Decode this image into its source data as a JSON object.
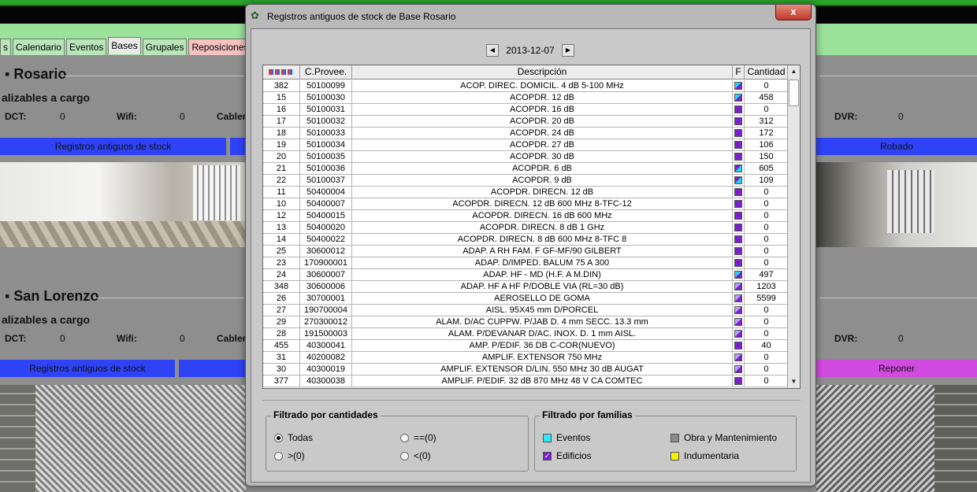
{
  "background": {
    "tabs": [
      "s",
      "Calendario",
      "Eventos",
      "Bases",
      "Grupales",
      "Reposiciones Exte"
    ],
    "active_tab": "Bases",
    "sections": [
      {
        "city": "Rosario",
        "subtitle": "alizables a cargo",
        "dct_label": "DCT:",
        "dct_value": "0",
        "wifi_label": "Wifi:",
        "wifi_value": "0",
        "cable_label": "Cabler",
        "dvr_label": "DVR:",
        "dvr_value": "0",
        "left_button": "Registros antiguos de stock",
        "right_button": "Robado"
      },
      {
        "city": "San Lorenzo",
        "subtitle": "alizables a cargo",
        "dct_label": "DCT:",
        "dct_value": "0",
        "wifi_label": "Wifi:",
        "wifi_value": "0",
        "cable_label": "Cabler",
        "dvr_label": "DVR:",
        "dvr_value": "0",
        "left_button": "Registros antiguos de stock",
        "right_button": "Reponer"
      }
    ]
  },
  "dialog": {
    "title": "Registros antiguos de stock de Base Rosario",
    "close_label": "x",
    "date": "2013-12-07",
    "columns": {
      "id": "",
      "cprovee": "C.Provee.",
      "descripcion": "Descripción",
      "f": "F",
      "cantidad": "Cantidad"
    },
    "rows": [
      {
        "id": "382",
        "cprovee": "50100099",
        "descripcion": "ACOP. DIREC. DOMICIL. 4 dB 5-100 MHz",
        "fam": "ev",
        "cantidad": "0"
      },
      {
        "id": "15",
        "cprovee": "50100030",
        "descripcion": "ACOPDR. 12 dB",
        "fam": "ev",
        "cantidad": "458"
      },
      {
        "id": "16",
        "cprovee": "50100031",
        "descripcion": "ACOPDR. 16 dB",
        "fam": "ed",
        "cantidad": "0"
      },
      {
        "id": "17",
        "cprovee": "50100032",
        "descripcion": "ACOPDR. 20 dB",
        "fam": "ed",
        "cantidad": "312"
      },
      {
        "id": "18",
        "cprovee": "50100033",
        "descripcion": "ACOPDR. 24 dB",
        "fam": "ed",
        "cantidad": "172"
      },
      {
        "id": "19",
        "cprovee": "50100034",
        "descripcion": "ACOPDR. 27 dB",
        "fam": "ed",
        "cantidad": "106"
      },
      {
        "id": "20",
        "cprovee": "50100035",
        "descripcion": "ACOPDR. 30 dB",
        "fam": "ed",
        "cantidad": "150"
      },
      {
        "id": "21",
        "cprovee": "50100036",
        "descripcion": "ACOPDR. 6 dB",
        "fam": "ev2",
        "cantidad": "605"
      },
      {
        "id": "22",
        "cprovee": "50100037",
        "descripcion": "ACOPDR. 9 dB",
        "fam": "ev2",
        "cantidad": "109"
      },
      {
        "id": "11",
        "cprovee": "50400004",
        "descripcion": "ACOPDR. DIRECN. 12 dB",
        "fam": "ed",
        "cantidad": "0"
      },
      {
        "id": "10",
        "cprovee": "50400007",
        "descripcion": "ACOPDR. DIRECN. 12 dB 600 MHz 8-TFC-12",
        "fam": "ed",
        "cantidad": "0"
      },
      {
        "id": "12",
        "cprovee": "50400015",
        "descripcion": "ACOPDR. DIRECN. 16 dB 600 MHz",
        "fam": "ed",
        "cantidad": "0"
      },
      {
        "id": "13",
        "cprovee": "50400020",
        "descripcion": "ACOPDR. DIRECN. 8 dB 1 GHz",
        "fam": "ed",
        "cantidad": "0"
      },
      {
        "id": "14",
        "cprovee": "50400022",
        "descripcion": "ACOPDR. DIRECN. 8 dB 600 MHz 8-TFC 8",
        "fam": "ed",
        "cantidad": "0"
      },
      {
        "id": "25",
        "cprovee": "30600012",
        "descripcion": "ADAP. A RH FAM. F GF-MF/90 GILBERT",
        "fam": "ed",
        "cantidad": "0"
      },
      {
        "id": "23",
        "cprovee": "170900001",
        "descripcion": "ADAP. D/IMPED. BALUM 75 A 300",
        "fam": "ed",
        "cantidad": "0"
      },
      {
        "id": "24",
        "cprovee": "30600007",
        "descripcion": "ADAP. HF - MD (H.F. A M.DIN)",
        "fam": "ev",
        "cantidad": "497"
      },
      {
        "id": "348",
        "cprovee": "30600006",
        "descripcion": "ADAP. HF A HF P/DOBLE VIA (RL=30 dB)",
        "fam": "mx",
        "cantidad": "1203"
      },
      {
        "id": "26",
        "cprovee": "30700001",
        "descripcion": "AEROSELLO DE GOMA",
        "fam": "mx",
        "cantidad": "5599"
      },
      {
        "id": "27",
        "cprovee": "190700004",
        "descripcion": "AISL. 95X45 mm D/PORCEL",
        "fam": "mx",
        "cantidad": "0"
      },
      {
        "id": "29",
        "cprovee": "270300012",
        "descripcion": "ALAM. D/AC CUPPW. P/JAB D. 4 mm SECC. 13.3 mm",
        "fam": "mx",
        "cantidad": "0"
      },
      {
        "id": "28",
        "cprovee": "191500003",
        "descripcion": "ALAM. P/DEVANAR D/AC. INOX. D. 1 mm AISL.",
        "fam": "mx",
        "cantidad": "0"
      },
      {
        "id": "455",
        "cprovee": "40300041",
        "descripcion": "AMP. P/EDIF. 36 DB C-COR(NUEVO)",
        "fam": "ed",
        "cantidad": "40"
      },
      {
        "id": "31",
        "cprovee": "40200082",
        "descripcion": "AMPLIF. EXTENSOR 750 MHz",
        "fam": "mx",
        "cantidad": "0"
      },
      {
        "id": "30",
        "cprovee": "40300019",
        "descripcion": "AMPLIF. EXTENSOR D/LIN. 550 MHz 30 dB AUGAT",
        "fam": "mx",
        "cantidad": "0"
      },
      {
        "id": "377",
        "cprovee": "40300038",
        "descripcion": "AMPLIF. P/EDIF. 32 dB 870 MHz 48 V CA COMTEC",
        "fam": "ed",
        "cantidad": "0"
      }
    ],
    "filter_qty": {
      "title": "Filtrado por cantidades",
      "options": [
        "Todas",
        "==(0)",
        ">(0)",
        "<(0)"
      ],
      "selected": "Todas"
    },
    "filter_fam": {
      "title": "Filtrado por familias",
      "options": [
        {
          "label": "Eventos",
          "color": "#2ee6f5",
          "checked": false
        },
        {
          "label": "Obra y Mantenimiento",
          "color": "#8a8a8a",
          "checked": false
        },
        {
          "label": "Edificios",
          "color": "#7a1fc9",
          "checked": true
        },
        {
          "label": "Indumentaria",
          "color": "#f2f200",
          "checked": false
        }
      ]
    }
  }
}
